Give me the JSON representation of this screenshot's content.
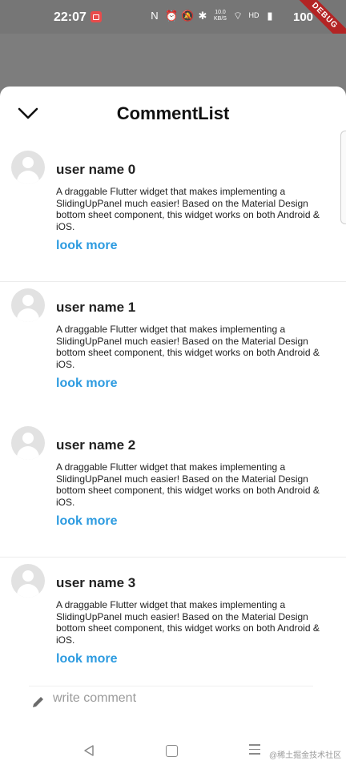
{
  "status": {
    "time": "22:07",
    "network_speed": "10.0 KB/S",
    "battery": "100",
    "debug_label": "DEBUG"
  },
  "sheet": {
    "title": "CommentList"
  },
  "comments": [
    {
      "user": "user name 0",
      "text": "A draggable Flutter widget that makes implementing a SlidingUpPanel much easier! Based on the Material Design bottom sheet component, this widget works on both Android & iOS.",
      "more": "look more"
    },
    {
      "user": "user name 1",
      "text": "A draggable Flutter widget that makes implementing a SlidingUpPanel much easier! Based on the Material Design bottom sheet component, this widget works on both Android & iOS.",
      "more": "look more"
    },
    {
      "user": "user name 2",
      "text": "A draggable Flutter widget that makes implementing a SlidingUpPanel much easier! Based on the Material Design bottom sheet component, this widget works on both Android & iOS.",
      "more": "look more"
    },
    {
      "user": "user name 3",
      "text": "A draggable Flutter widget that makes implementing a SlidingUpPanel much easier! Based on the Material Design bottom sheet component, this widget works on both Android & iOS.",
      "more": "look more"
    }
  ],
  "composer": {
    "placeholder": "write comment"
  },
  "watermark": "@稀土掘金技术社区",
  "colors": {
    "accent": "#2d9be0",
    "debug": "#b32424"
  }
}
